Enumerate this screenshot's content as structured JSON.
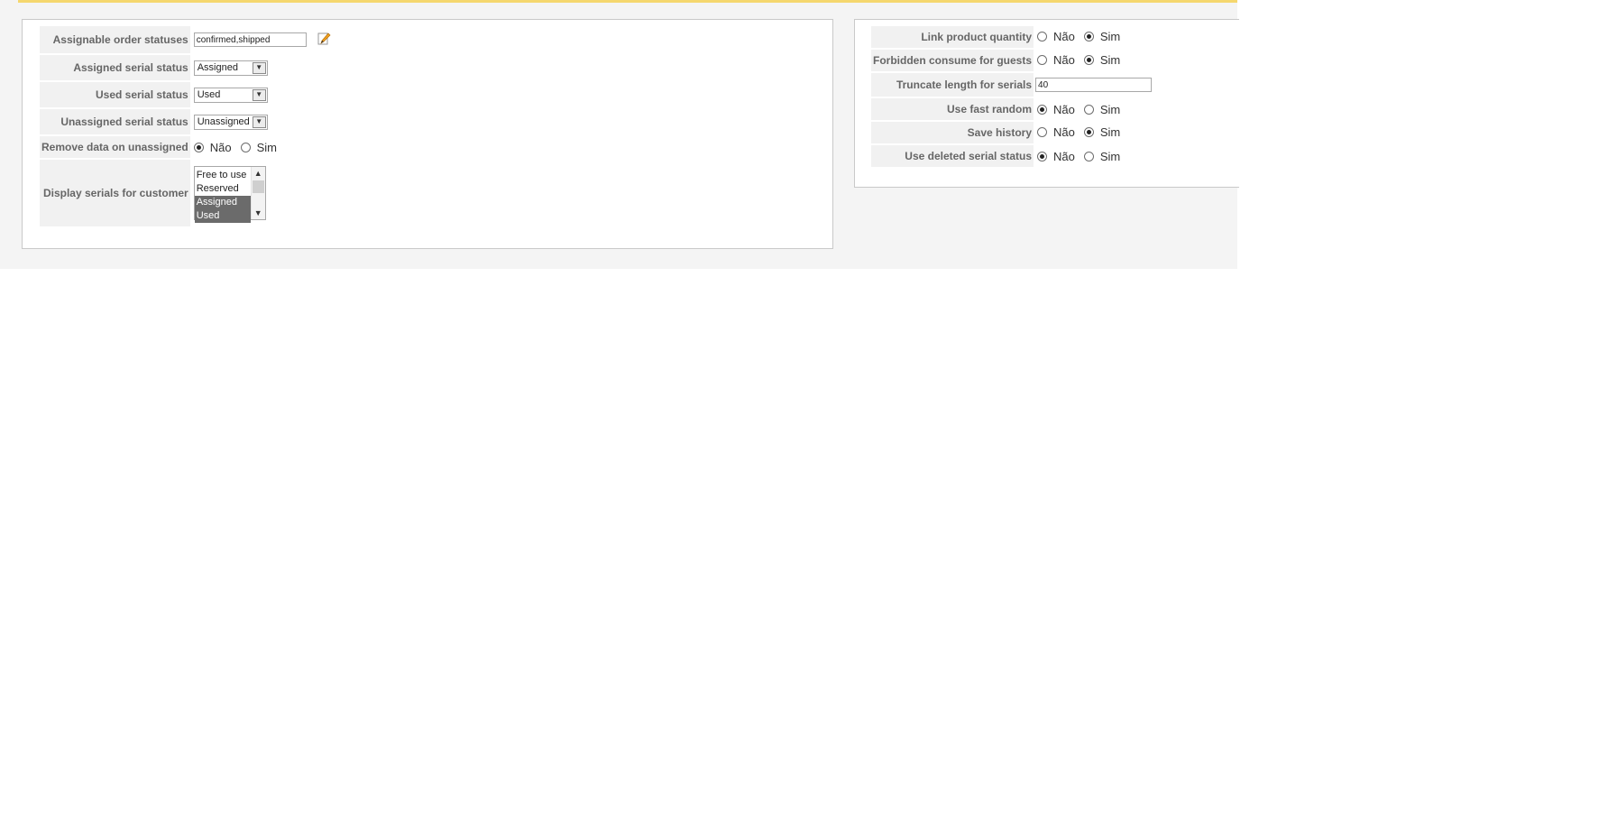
{
  "left_panel": {
    "rows": [
      {
        "label": "Assignable order statuses",
        "value": "confirmed,shipped"
      },
      {
        "label": "Assigned serial status",
        "value": "Assigned"
      },
      {
        "label": "Used serial status",
        "value": "Used"
      },
      {
        "label": "Unassigned serial status",
        "value": "Unassigned"
      },
      {
        "label": "Remove data on unassigned",
        "no": "Não",
        "yes": "Sim",
        "selected": "no"
      },
      {
        "label": "Display serials for customer",
        "options": [
          "Free to use",
          "Reserved",
          "Assigned",
          "Used"
        ],
        "selected": [
          "Assigned",
          "Used"
        ]
      }
    ]
  },
  "right_panel": {
    "rows": [
      {
        "label": "Link product quantity",
        "no": "Não",
        "yes": "Sim",
        "selected": "yes"
      },
      {
        "label": "Forbidden consume for guests",
        "no": "Não",
        "yes": "Sim",
        "selected": "yes"
      },
      {
        "label": "Truncate length for serials",
        "value": "40"
      },
      {
        "label": "Use fast random",
        "no": "Não",
        "yes": "Sim",
        "selected": "no"
      },
      {
        "label": "Save history",
        "no": "Não",
        "yes": "Sim",
        "selected": "yes"
      },
      {
        "label": "Use deleted serial status",
        "no": "Não",
        "yes": "Sim",
        "selected": "no"
      }
    ]
  },
  "icons": {
    "edit": "edit-pencil-icon"
  },
  "colors": {
    "accent": "#f5d76e",
    "label_bg": "#f1f1f1",
    "selected_option": "#6b6b6b"
  }
}
